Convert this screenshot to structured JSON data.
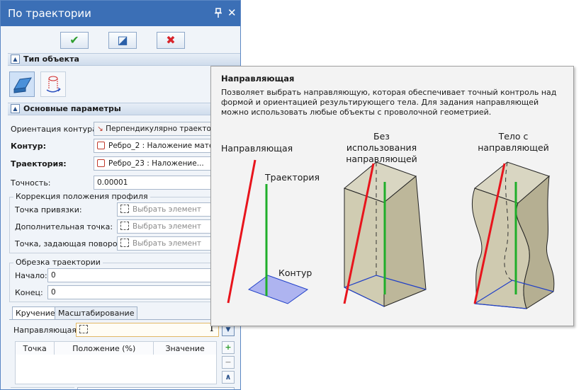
{
  "panel": {
    "title": "По траектории",
    "pin_icon": "pin-icon",
    "close_glyph": "✕",
    "toolbar": {
      "ok": "✔",
      "preview": "◪",
      "cancel": "✖"
    },
    "sections": {
      "object_type": "Тип объекта",
      "main_params": "Основные параметры"
    },
    "orientation": {
      "label": "Ориентация контура:",
      "value": "Перпендикулярно траектор"
    },
    "contour": {
      "label": "Контур:",
      "value": "Ребро_2 : Наложение мате..."
    },
    "trajectory": {
      "label": "Траектория:",
      "value": "Ребро_23 : Наложение..."
    },
    "precision": {
      "label": "Точность:",
      "value": "0.00001"
    },
    "correction": {
      "title": "Коррекция положения профиля",
      "rows": [
        {
          "label": "Точка привязки:",
          "placeholder": "Выбрать элемент"
        },
        {
          "label": "Дополнительная точка:",
          "placeholder": "Выбрать элемент"
        },
        {
          "label": "Точка, задающая поворот:",
          "placeholder": "Выбрать элемент"
        }
      ]
    },
    "trim": {
      "title": "Обрезка траектории",
      "start": {
        "label": "Начало:",
        "value": "0"
      },
      "end": {
        "label": "Конец:",
        "value": "0"
      }
    },
    "tabs": [
      "Кручение",
      "Масштабирование"
    ],
    "guide": {
      "label": "Направляющая:"
    },
    "grid": {
      "columns": [
        "Точка",
        "Положение (%)",
        "Значение"
      ]
    },
    "side_buttons": {
      "add": "+",
      "remove": "−",
      "graph": "∧"
    }
  },
  "tooltip": {
    "title": "Направляющая",
    "description": "Позволяет выбрать направляющую, которая обеспечивает точный контроль над формой и ориентацией результирующего тела. Для задания направляющей можно использовать любые объекты с проволочной геометрией.",
    "captions": {
      "guide": "Направляющая",
      "trajectory": "Траектория",
      "contour": "Контур",
      "without_guide": [
        "Без использования",
        "направляющей"
      ],
      "with_guide": [
        "Тело с",
        "направляющей"
      ]
    },
    "colors": {
      "guide": "#e8141c",
      "trajectory": "#1fae2a",
      "contour": "#1f3fc8",
      "body": "#c9c4a8"
    }
  }
}
